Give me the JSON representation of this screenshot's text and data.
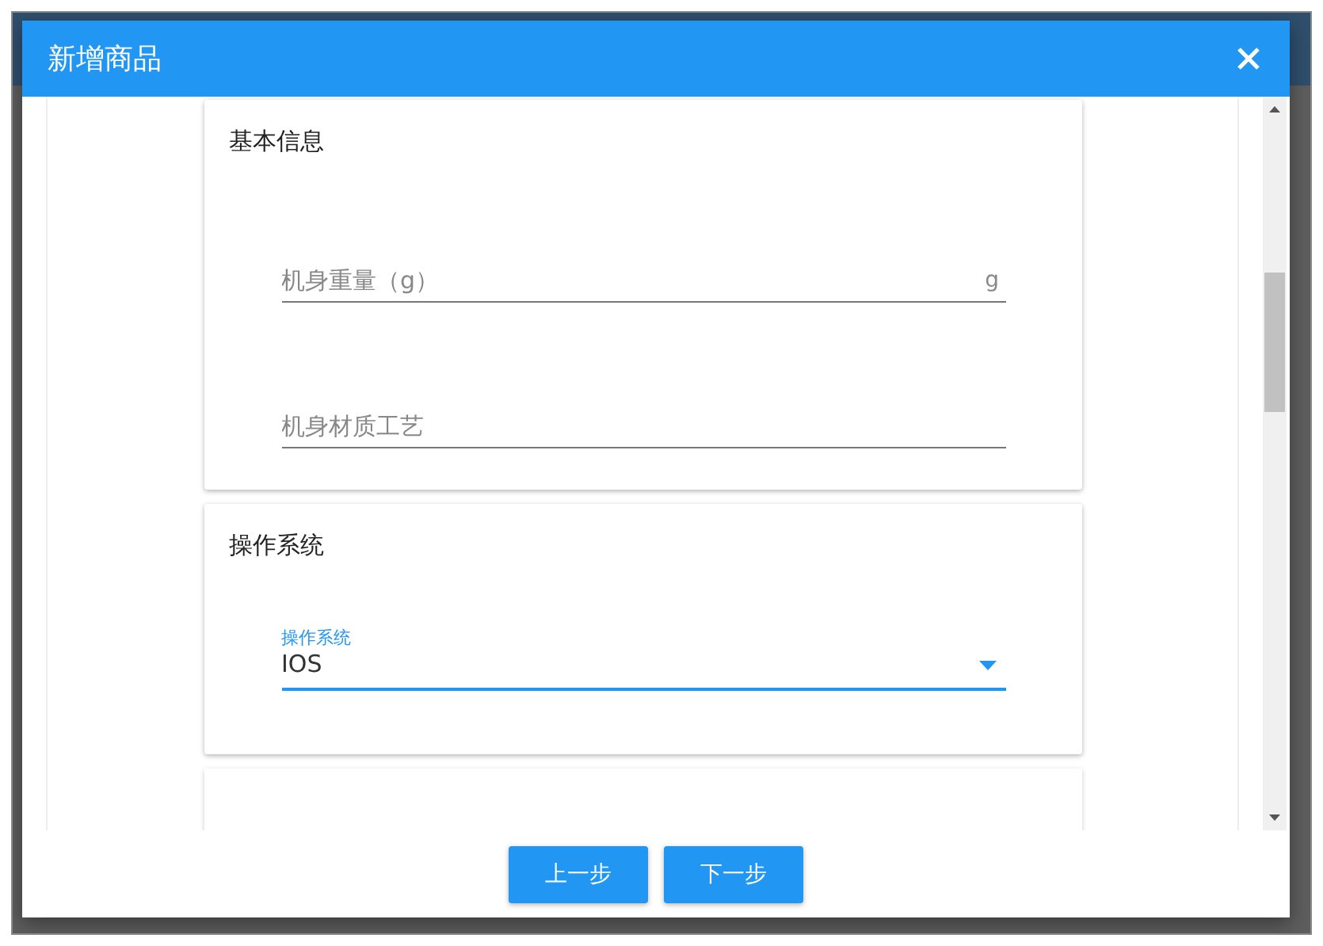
{
  "dialog": {
    "title": "新增商品"
  },
  "sections": [
    {
      "title": "基本信息",
      "fields": [
        {
          "kind": "text",
          "placeholder": "机身重量（g）",
          "suffix": "g",
          "focused": false
        },
        {
          "kind": "text",
          "placeholder": "机身材质工艺",
          "focused": false
        }
      ]
    },
    {
      "title": "操作系统",
      "fields": [
        {
          "kind": "select",
          "label": "操作系统",
          "value": "IOS",
          "focused": true
        }
      ]
    }
  ],
  "buttons": [
    "上一步",
    "下一步"
  ]
}
